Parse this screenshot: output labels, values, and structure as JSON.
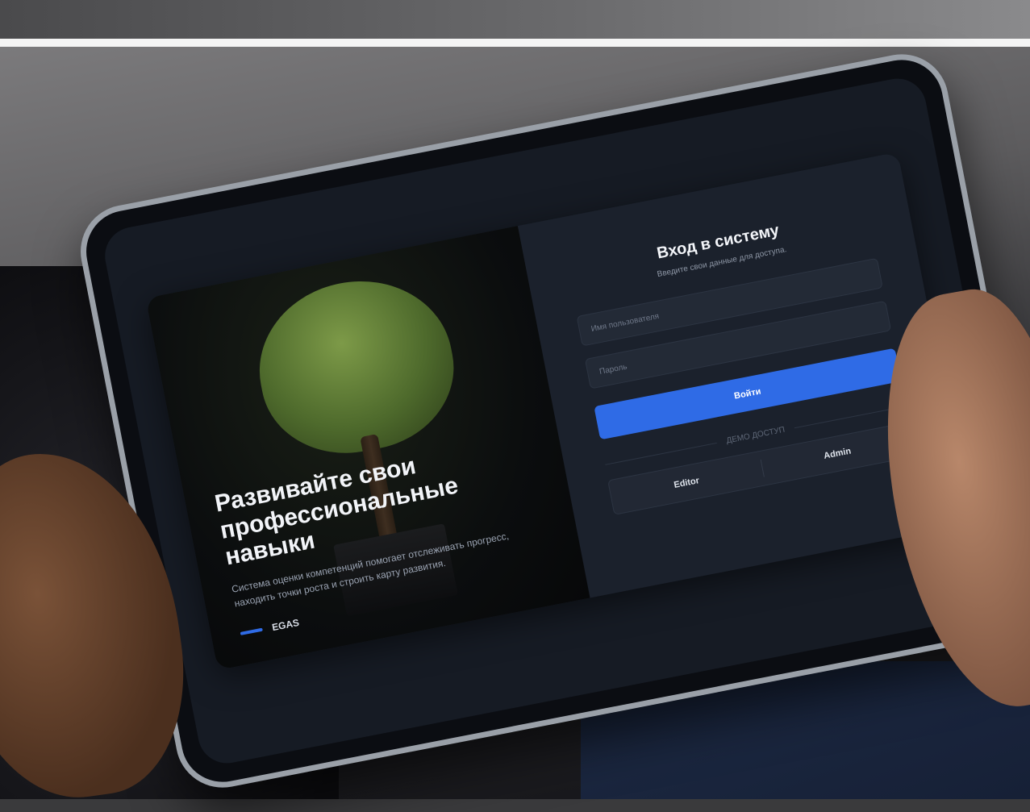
{
  "hero": {
    "title_line1": "Развивайте свои",
    "title_line2": "профессиональные",
    "title_line3": "навыки",
    "description": "Система оценки компетенций помогает отслеживать прогресс, находить точки роста и строить карту развития.",
    "brand": "EGAS"
  },
  "form": {
    "title": "Вход в систему",
    "subtitle": "Введите свои данные для доступа.",
    "username_placeholder": "Имя пользователя",
    "password_placeholder": "Пароль",
    "submit_label": "Войти",
    "demo_label": "ДЕМО ДОСТУП",
    "demo_editor": "Editor",
    "demo_admin": "Admin"
  },
  "colors": {
    "accent": "#2f6be6",
    "panel": "#1b212c",
    "screen": "#161b24"
  },
  "icons": {
    "brand_mark": "blue-bar-mark"
  }
}
